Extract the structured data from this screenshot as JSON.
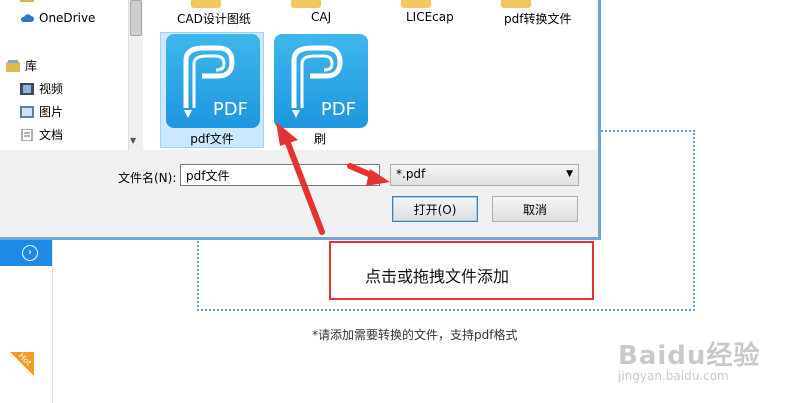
{
  "nav": {
    "items": [
      {
        "label": "OneDrive",
        "icon": "cloud-icon"
      },
      {
        "label": "库",
        "icon": "library-icon"
      },
      {
        "label": "视频",
        "icon": "video-icon"
      },
      {
        "label": "图片",
        "icon": "picture-icon"
      },
      {
        "label": "文档",
        "icon": "document-icon"
      }
    ]
  },
  "files": {
    "top_row": [
      "CAD设计图纸",
      "CAJ",
      "LICEcap",
      "pdf转换文件"
    ],
    "items": [
      {
        "label": "pdf文件",
        "badge": "PDF"
      },
      {
        "label": "刷",
        "badge": "PDF"
      }
    ]
  },
  "dialog": {
    "filename_label": "文件名(N):",
    "filename_value": "pdf文件",
    "filetype_value": "*.pdf",
    "open_label": "打开(O)",
    "cancel_label": "取消"
  },
  "app": {
    "hint": "*请添加需要转换的文件，支持pdf格式",
    "hot_label": "Hot",
    "accent": "#1f8ae6"
  },
  "annotation": {
    "text": "点击或拖拽文件添加",
    "color": "#e53333"
  },
  "watermark": {
    "brand": "Baidu经验",
    "url": "jingyan.baidu.com"
  }
}
